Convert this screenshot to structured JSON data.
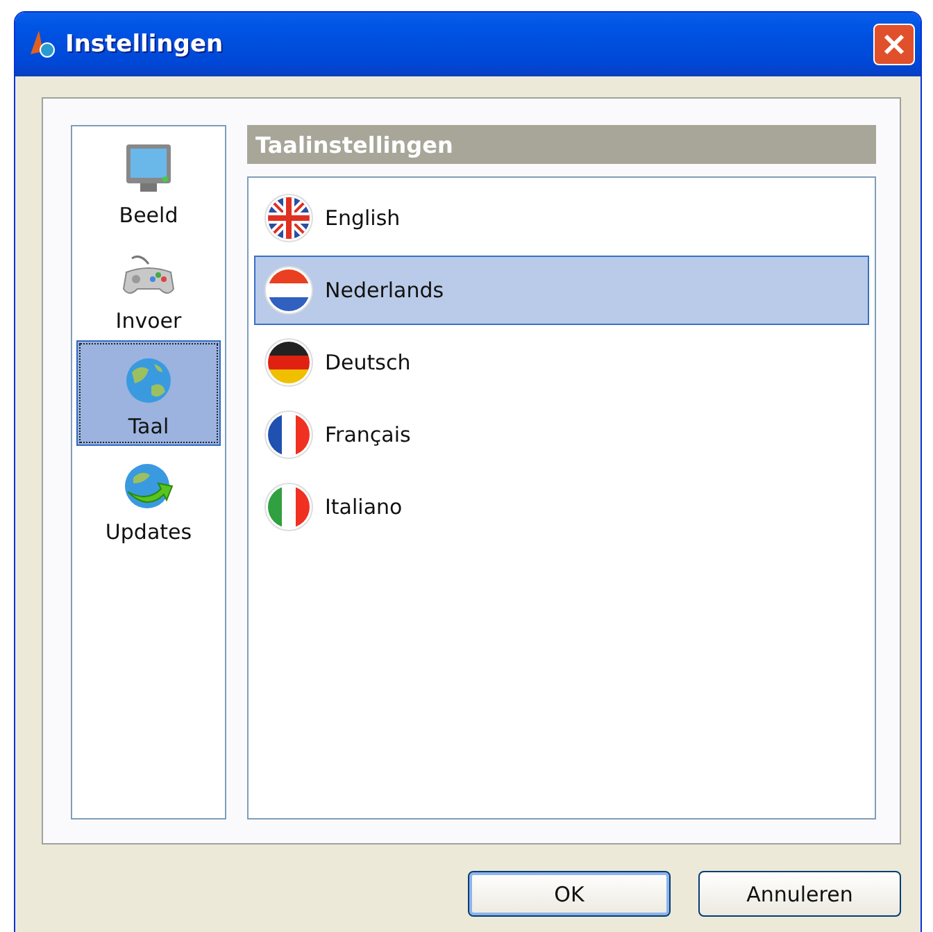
{
  "window": {
    "title": "Instellingen"
  },
  "sidebar": {
    "items": [
      {
        "label": "Beeld",
        "selected": false
      },
      {
        "label": "Invoer",
        "selected": false
      },
      {
        "label": "Taal",
        "selected": true
      },
      {
        "label": "Updates",
        "selected": false
      }
    ]
  },
  "panel": {
    "title": "Taalinstellingen",
    "languages": [
      {
        "label": "English",
        "selected": false
      },
      {
        "label": "Nederlands",
        "selected": true
      },
      {
        "label": "Deutsch",
        "selected": false
      },
      {
        "label": "Français",
        "selected": false
      },
      {
        "label": "Italiano",
        "selected": false
      }
    ]
  },
  "buttons": [
    "OK",
    "Annuleren"
  ]
}
